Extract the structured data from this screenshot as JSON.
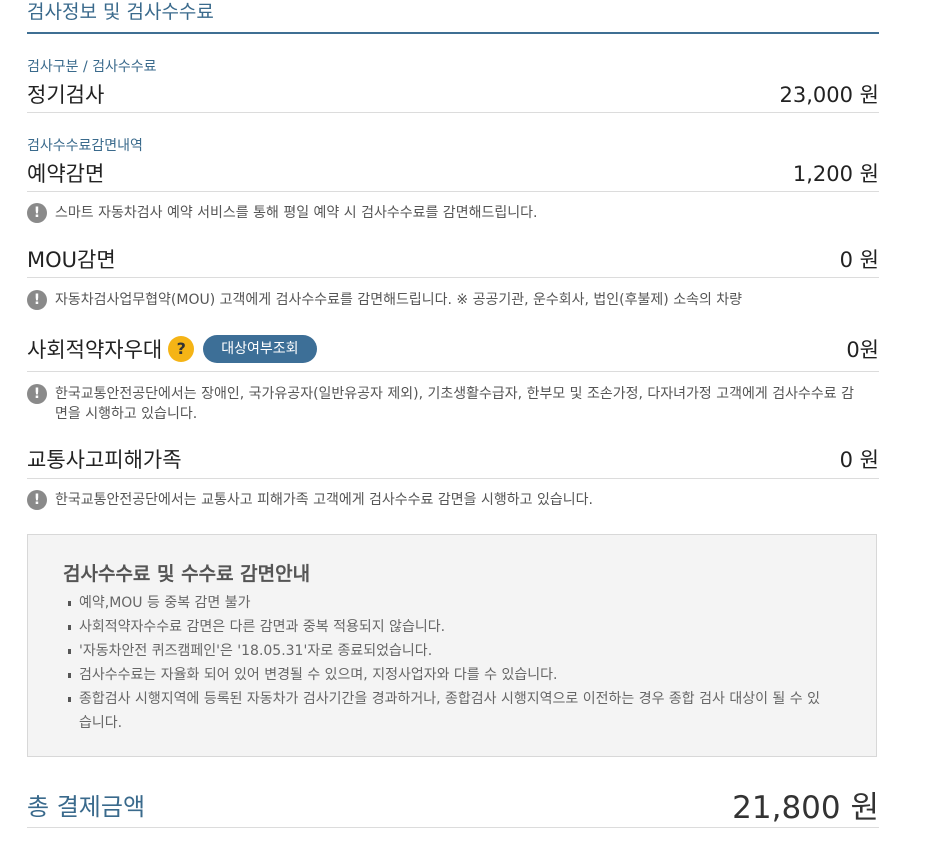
{
  "section": {
    "title": "검사정보 및 검사수수료"
  },
  "inspection": {
    "category_label": "검사구분 / 검사수수료",
    "type": "정기검사",
    "fee": "23,000 원"
  },
  "discount": {
    "category_label": "검사수수료감면내역",
    "reservation": {
      "label": "예약감면",
      "amount": "1,200 원",
      "note": "스마트 자동차검사 예약 서비스를 통해 평일 예약 시 검사수수료를 감면해드립니다."
    },
    "mou": {
      "label": "MOU감면",
      "amount": "0 원",
      "note": "자동차검사업무협약(MOU) 고객에게 검사수수료를 감면해드립니다. ※ 공공기관, 운수회사, 법인(후불제) 소속의 차량"
    },
    "social": {
      "label": "사회적약자우대",
      "help_icon": "?",
      "lookup_button": "대상여부조회",
      "amount": "0원",
      "note": "한국교통안전공단에서는 장애인, 국가유공자(일반유공자 제외), 기초생활수급자, 한부모 및 조손가정, 다자녀가정 고객에게 검사수수료 감면을 시행하고 있습니다."
    },
    "accident": {
      "label": "교통사고피해가족",
      "amount": "0 원",
      "note": "한국교통안전공단에서는 교통사고 피해가족 고객에게 검사수수료 감면을 시행하고 있습니다."
    }
  },
  "warning_icon": "!",
  "guide": {
    "title": "검사수수료 및 수수료 감면안내",
    "items": [
      "예약,MOU 등 중복 감면 불가",
      "사회적약자수수료 감면은 다른 감면과 중복 적용되지 않습니다.",
      "'자동차안전 퀴즈캠페인'은 '18.05.31'자로 종료되었습니다.",
      "검사수수료는 자율화 되어 있어 변경될 수 있으며, 지정사업자와 다를 수 있습니다.",
      "종합검사 시행지역에 등록된 자동차가 검사기간을 경과하거나, 종합검사 시행지역으로 이전하는 경우 종합 검사 대상이 될 수 있습니다."
    ]
  },
  "total": {
    "label": "총 결제금액",
    "amount": "21,800 원"
  },
  "colors": {
    "accent": "#3a6a8c",
    "button": "#3d6f97",
    "help": "#f5b416",
    "warn_icon": "#8a8a8a"
  }
}
